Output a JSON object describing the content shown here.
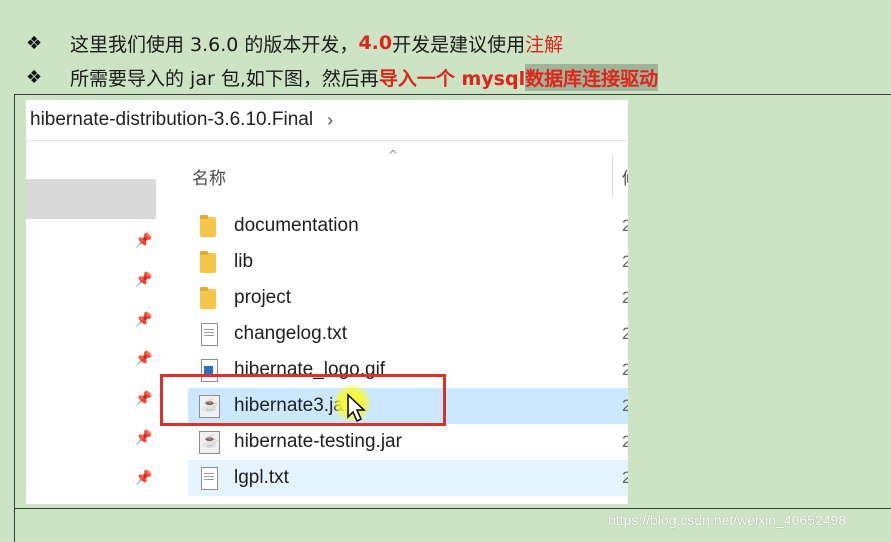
{
  "slide": {
    "line1": {
      "bullet": "❖",
      "text_prefix": "这里我们使用 3.6.0 的版本开发，",
      "text_red": "4.0",
      "text_middle": " 开发是建议使用",
      "text_red_tail": "注解"
    },
    "line2": {
      "bullet": "❖",
      "text_prefix": "所需要导入的 jar 包,如下图，然后再",
      "text_red": "导入一个 mysql ",
      "text_highlight": "数据库连接驱动"
    }
  },
  "explorer": {
    "path": "hibernate-distribution-3.6.10.Final",
    "path_chevron": "›",
    "column_header_name": "名称",
    "column_header_next": "修",
    "sort_indicator": "^",
    "pin_icon": "📌",
    "files": [
      {
        "name": "documentation",
        "icon": "folder-icon",
        "date": "2"
      },
      {
        "name": "lib",
        "icon": "folder-icon",
        "date": "2"
      },
      {
        "name": "project",
        "icon": "folder-icon",
        "date": "2"
      },
      {
        "name": "changelog.txt",
        "icon": "text-file-icon",
        "date": "2"
      },
      {
        "name": "hibernate_logo.gif",
        "icon": "image-file-icon",
        "date": "2"
      },
      {
        "name": "hibernate3.jar",
        "icon": "jar-file-icon",
        "date": "2",
        "state": "selected"
      },
      {
        "name": "hibernate-testing.jar",
        "icon": "jar-file-icon",
        "date": "2"
      },
      {
        "name": "lgpl.txt",
        "icon": "text-file-icon",
        "date": "2",
        "state": "hovered"
      }
    ]
  },
  "watermark": "https://blog.csdn.net/weixin_40652498",
  "colors": {
    "background": "#cce3c4",
    "accent_red": "#e0241a",
    "annotation_box": "#d8322a",
    "selection": "#cce8ff"
  }
}
